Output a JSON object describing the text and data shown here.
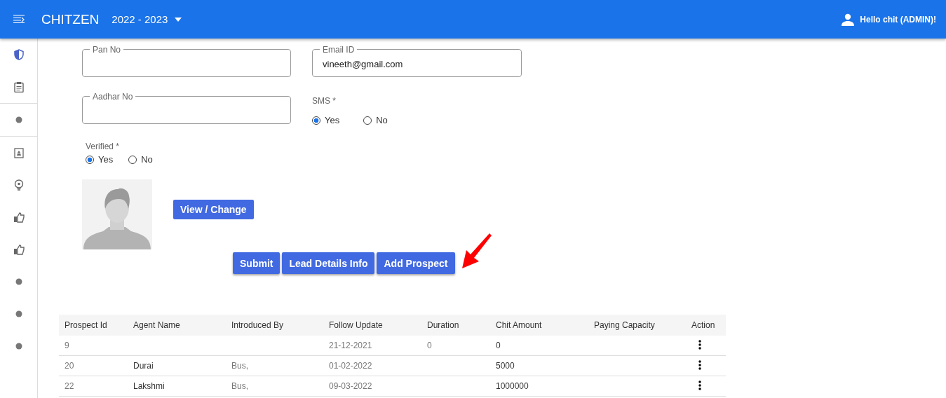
{
  "header": {
    "brand": "CHITZEN",
    "year": "2022 - 2023",
    "user": "Hello chit (ADMIN)!"
  },
  "sidebar": {
    "items": [
      {
        "kind": "shield"
      },
      {
        "kind": "clipboard"
      },
      {
        "kind": "dot",
        "divided": true
      },
      {
        "kind": "badge"
      },
      {
        "kind": "bulb"
      },
      {
        "kind": "thumb"
      },
      {
        "kind": "thumb"
      },
      {
        "kind": "dot",
        "divided": false
      },
      {
        "kind": "dot",
        "divided": false
      },
      {
        "kind": "dot",
        "divided": false
      }
    ]
  },
  "form": {
    "fields": [
      {
        "label": "Pan No"
      },
      {
        "label": "Email ID",
        "value": "vineeth@gmail.com"
      },
      {
        "label": "Aadhar No"
      }
    ],
    "sms": {
      "label": "SMS *",
      "options": [
        {
          "label": "Yes",
          "selected": true
        },
        {
          "label": "No",
          "selected": false
        }
      ]
    },
    "verified": {
      "label": "Verified *",
      "options": [
        {
          "label": "Yes",
          "selected": true
        },
        {
          "label": "No",
          "selected": false
        }
      ]
    },
    "photo_button": "View / Change",
    "buttons": [
      "Submit",
      "Lead Details Info",
      "Add Prospect"
    ]
  },
  "table": {
    "columns": [
      "Prospect Id",
      "Agent Name",
      "Introduced By",
      "Follow Update",
      "Duration",
      "Chit Amount",
      "Paying Capacity",
      "Action"
    ],
    "rows": [
      {
        "cells": [
          "9",
          "",
          "",
          "21-12-2021",
          "0",
          "0",
          ""
        ]
      },
      {
        "cells": [
          "20",
          "Durai",
          "Bus,",
          "01-02-2022",
          "",
          "5000",
          ""
        ]
      },
      {
        "cells": [
          "22",
          "Lakshmi",
          "Bus,",
          "09-03-2022",
          "",
          "1000000",
          ""
        ]
      }
    ]
  }
}
